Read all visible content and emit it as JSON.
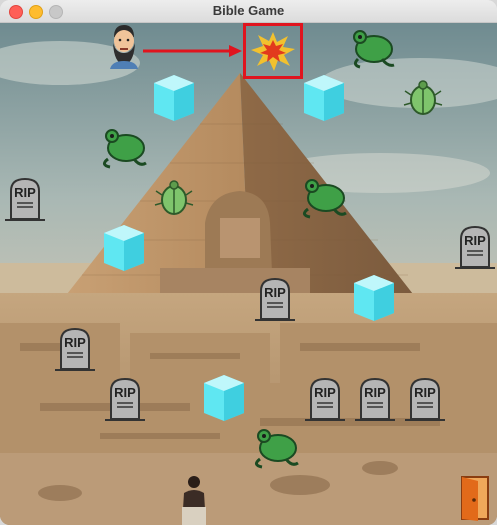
{
  "window": {
    "title": "Bible Game"
  },
  "scene": {
    "background": "pyramid-and-sphinx-desert",
    "tombstone_text": "RIP",
    "colors": {
      "sky": "#8fa3a6",
      "pyramid": "#a8815a",
      "ground": "#b08b64",
      "ice": "#5fe7f2",
      "frog": "#3fa047",
      "beetle": "#7fc46c",
      "target_frame": "#e0141e",
      "arrow": "#e0141e",
      "door": "#e26a1a"
    }
  },
  "player": {
    "icon": "bearded-man-avatar"
  },
  "goal": {
    "icon": "explosion-icon"
  },
  "exit": {
    "icon": "door-icon"
  }
}
